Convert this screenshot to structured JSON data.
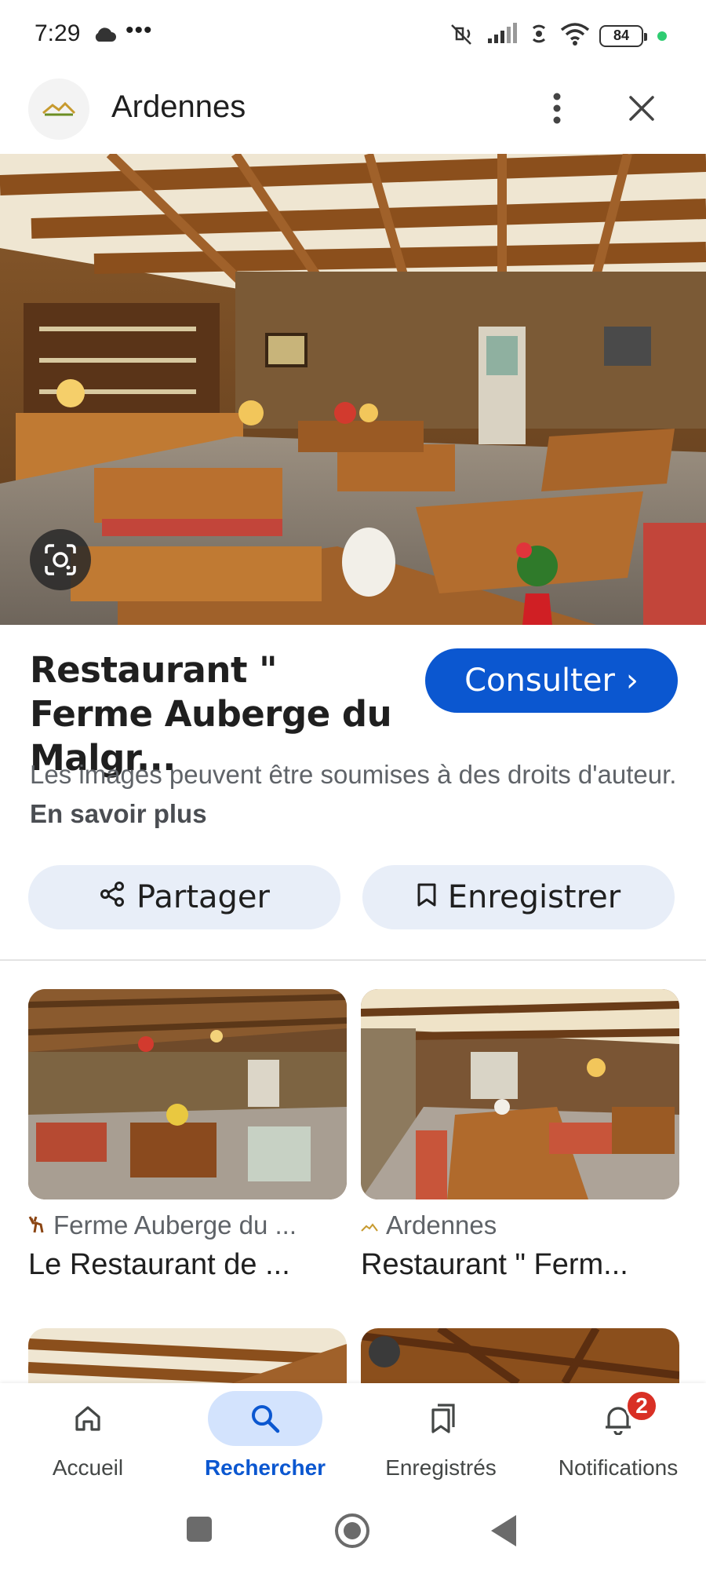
{
  "status_bar": {
    "time": "7:29",
    "dots": "•••",
    "battery": "84"
  },
  "header": {
    "title": "Ardennes",
    "logo_icon": "ardennes-logo-icon",
    "more_icon": "more-vert-icon",
    "close_icon": "close-icon"
  },
  "result": {
    "title": "Restaurant \" Ferme Auberge du Malgr...",
    "visit_label": "Consulter",
    "visit_chevron": "›",
    "copyright_text": "Les images peuvent être soumises à des droits d'auteur.",
    "learn_more": "En savoir plus"
  },
  "actions": {
    "share_label": "Partager",
    "save_label": "Enregistrer"
  },
  "related": [
    {
      "source": "Ferme Auberge du ...",
      "title": "Le Restaurant de ..."
    },
    {
      "source": "Ardennes",
      "title": "Restaurant \" Ferm..."
    }
  ],
  "bottom_nav": {
    "items": [
      {
        "label": "Accueil",
        "icon": "home-icon"
      },
      {
        "label": "Rechercher",
        "icon": "search-icon"
      },
      {
        "label": "Enregistrés",
        "icon": "collections-icon"
      },
      {
        "label": "Notifications",
        "icon": "bell-icon"
      }
    ],
    "active": "Rechercher",
    "notification_count": "2"
  },
  "colors": {
    "accent": "#0b57d0",
    "pill_bg": "#e8eef8",
    "badge": "#d93025"
  }
}
